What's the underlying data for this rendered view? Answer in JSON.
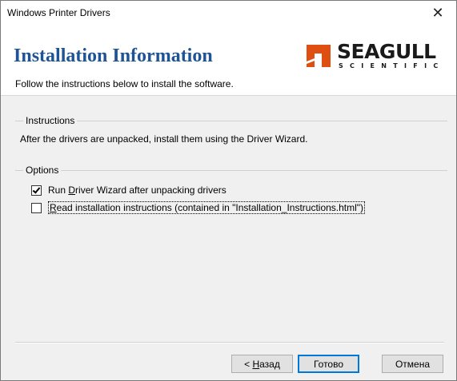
{
  "window": {
    "title": "Windows Printer Drivers",
    "close_glyph": "✕"
  },
  "header": {
    "title": "Installation Information",
    "subtitle": "Follow the instructions below to install the software.",
    "logo": {
      "word": "SEAGULL",
      "sub": "SCIENTIFIC",
      "brand_color": "#e04f12"
    }
  },
  "instructions": {
    "label": "Instructions",
    "text": "After the drivers are unpacked, install them using the Driver Wizard."
  },
  "options": {
    "label": "Options",
    "items": [
      {
        "pre": "Run ",
        "accel": "D",
        "post": "river Wizard after unpacking drivers",
        "checked": true
      },
      {
        "pre": "",
        "accel": "R",
        "post": "ead installation instructions (contained in \"Installation_Instructions.html\")",
        "checked": false
      }
    ]
  },
  "buttons": {
    "back": {
      "pre": "< ",
      "accel": "Н",
      "post": "азад"
    },
    "finish": "Готово",
    "cancel": "Отмена"
  }
}
